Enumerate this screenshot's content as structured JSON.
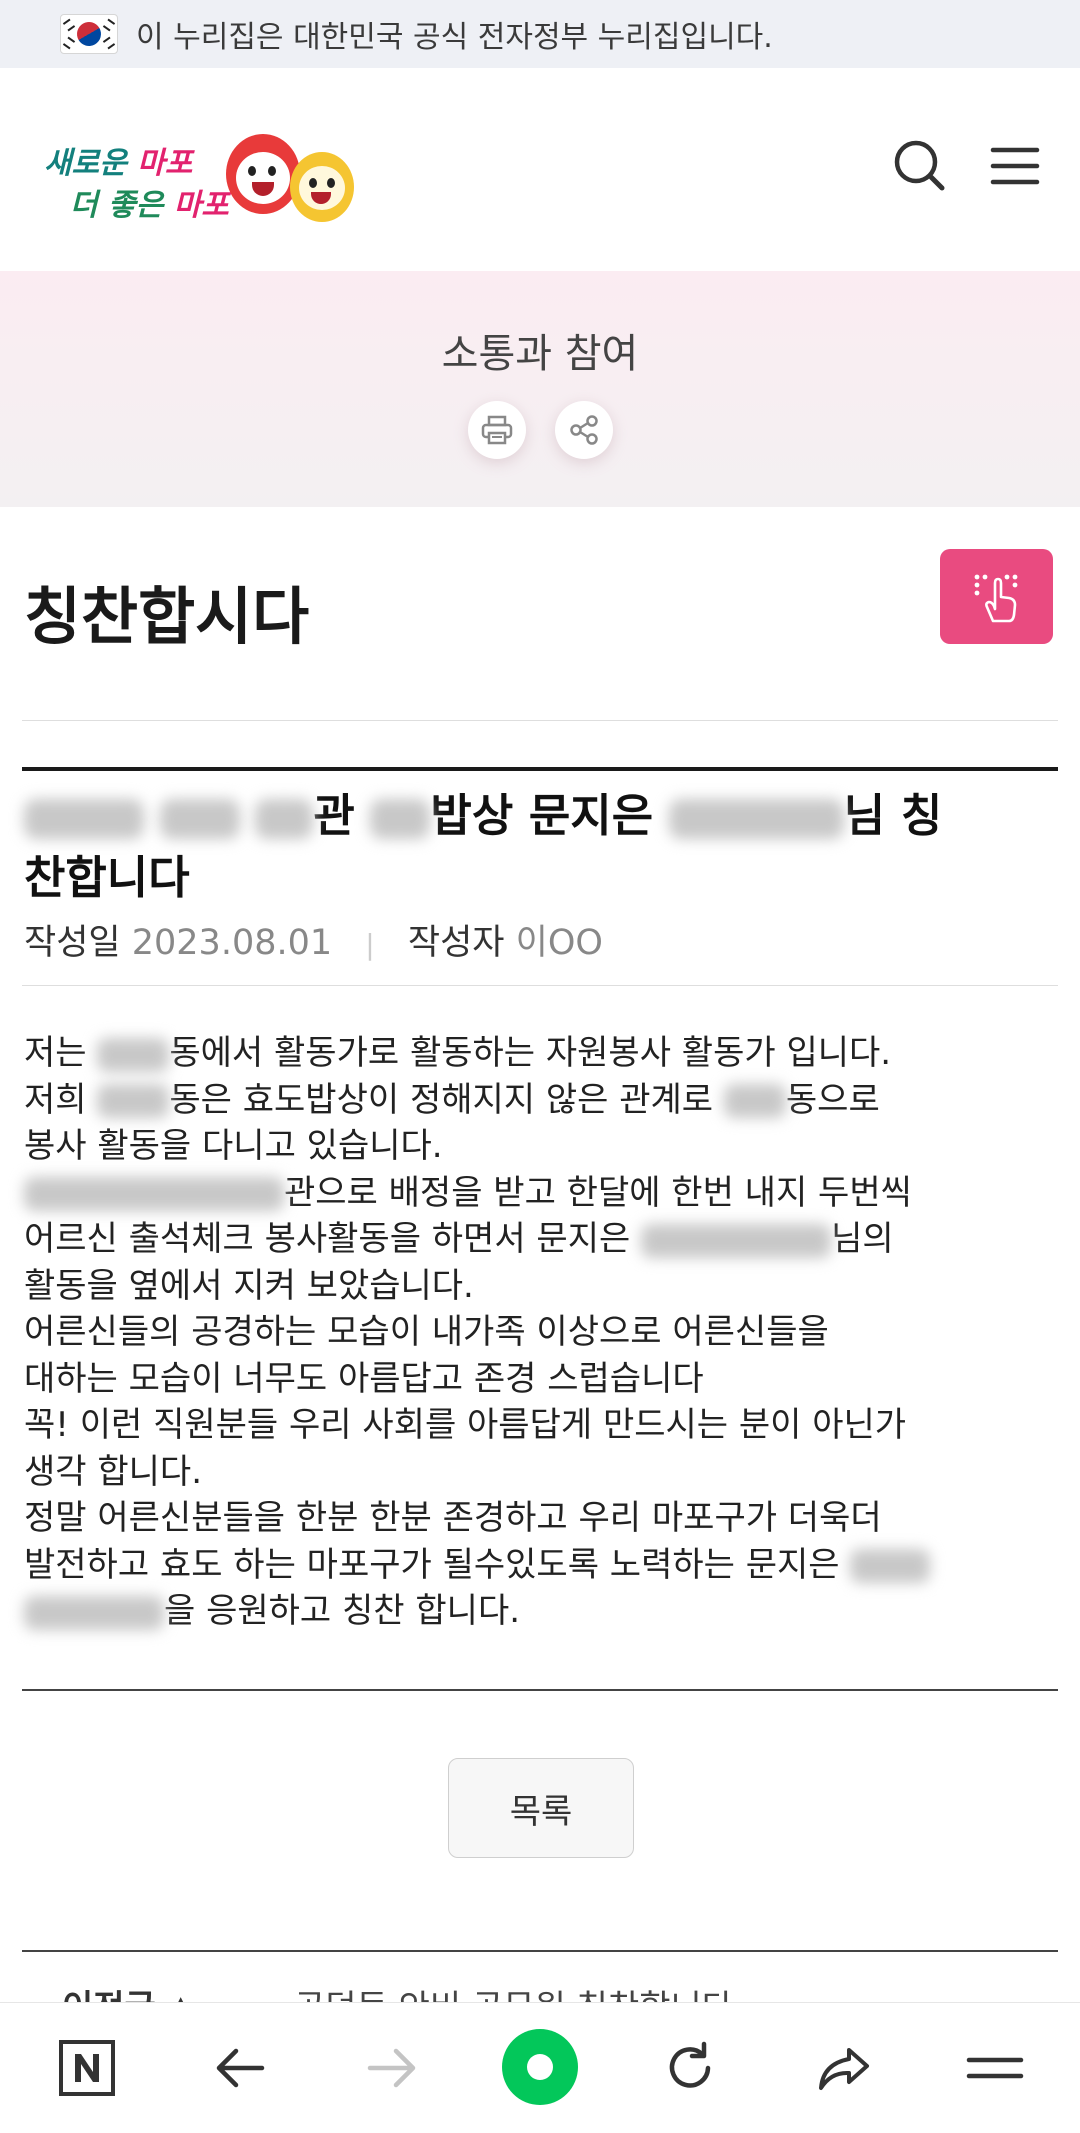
{
  "gov_banner": {
    "text": "이 누리집은 대한민국 공식 전자정부 누리집입니다."
  },
  "header": {
    "logo_line1_a": "새로운 ",
    "logo_line1_b": "마포",
    "logo_line2_a": "더 좋은 ",
    "logo_line2_b": "마포",
    "search_icon": "search-icon",
    "menu_icon": "hamburger-menu-icon"
  },
  "hero": {
    "title": "소통과 참여",
    "print_icon": "print-icon",
    "share_icon": "share-icon"
  },
  "page": {
    "title": "칭찬합시다",
    "braille_icon": "braille-touch-icon",
    "braille_color": "#e94b80"
  },
  "post": {
    "title_part1": "관 ",
    "title_part2": "밥상 문지은 ",
    "title_part3": "님 칭",
    "title_line2": "찬합니다",
    "date_label": "작성일",
    "date_value": "2023.08.01",
    "author_label": "작성자",
    "author_value": "이OO",
    "body": {
      "l1a": "저는 ",
      "l1b": "동에서 활동가로 활동하는 자원봉사 활동가 입니다.",
      "l2a": "저희 ",
      "l2b": "동은 효도밥상이 정해지지 않은 관계로 ",
      "l2c": "동으로",
      "l3": "봉사 활동을 다니고 있습니다.",
      "l4a": "관으로 배정을 받고 한달에 한번 내지 두번씩",
      "l5a": "어르신 출석체크 봉사활동을 하면서 문지은 ",
      "l5b": "님의",
      "l6": "활동을 옆에서 지켜 보았습니다.",
      "l7": "어른신들의 공경하는 모습이 내가족 이상으로 어른신들을",
      "l8": "대하는 모습이 너무도 아름답고 존경 스럽습니다",
      "l9": "꼭! 이런 직원분들 우리 사회를 아름답게 만드시는 분이 아닌가",
      "l10": "생각 합니다.",
      "l11": "정말 어른신분들을 한분 한분 존경하고 우리 마포구가 더욱더",
      "l12": "발전하고 효도 하는 마포구가 될수있도록 노력하는 문지은 ",
      "l13b": "을 응원하고 칭찬 합니다."
    }
  },
  "list_button": {
    "label": "목록"
  },
  "prev": {
    "label": "이전글 ▲",
    "title": "공덕동 안비 공무원 칭찬합니다"
  },
  "browser_bar": {
    "icons": [
      "naver-n-icon",
      "back-arrow-icon",
      "forward-arrow-icon",
      "naver-green-dot-icon",
      "reload-icon",
      "share-icon",
      "menu-icon"
    ],
    "green": "#03c75a"
  }
}
